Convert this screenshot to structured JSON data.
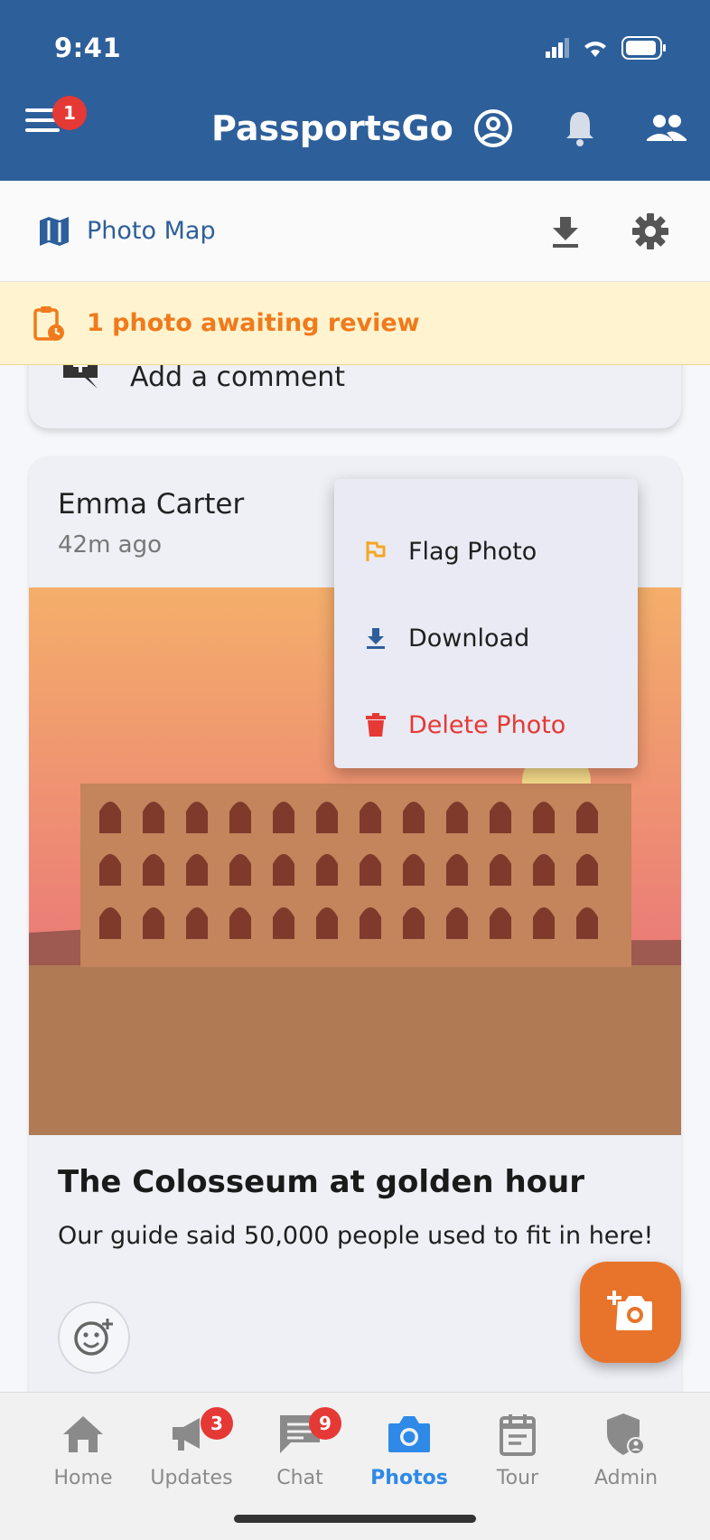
{
  "status_bar": {
    "time": "9:41"
  },
  "header": {
    "title": "PassportsGo",
    "menu_badge": "1"
  },
  "subheader": {
    "label": "Photo Map"
  },
  "review_banner": {
    "text": "1 photo awaiting review"
  },
  "comment_card": {
    "placeholder": "Add a comment"
  },
  "post": {
    "author": "Emma Carter",
    "time": "42m ago",
    "title": "The Colosseum at golden hour",
    "caption": "Our guide said 50,000 people used to fit in here!"
  },
  "context_menu": {
    "items": [
      {
        "label": "Flag Photo",
        "icon": "flag-icon"
      },
      {
        "label": "Download",
        "icon": "download-icon"
      },
      {
        "label": "Delete Photo",
        "icon": "trash-icon"
      }
    ]
  },
  "bottom_nav": {
    "items": [
      {
        "label": "Home",
        "icon": "home-icon"
      },
      {
        "label": "Updates",
        "icon": "megaphone-icon",
        "badge": "3"
      },
      {
        "label": "Chat",
        "icon": "chat-icon",
        "badge": "9"
      },
      {
        "label": "Photos",
        "icon": "camera-icon"
      },
      {
        "label": "Tour",
        "icon": "clipboard-icon"
      },
      {
        "label": "Admin",
        "icon": "admin-shield-icon"
      }
    ],
    "active": "Photos"
  },
  "colors": {
    "header_bg": "#2d5f9a",
    "accent_orange": "#e8742c",
    "banner_text": "#f07a1c",
    "danger": "#e53935",
    "active_nav": "#2e8ae6"
  }
}
